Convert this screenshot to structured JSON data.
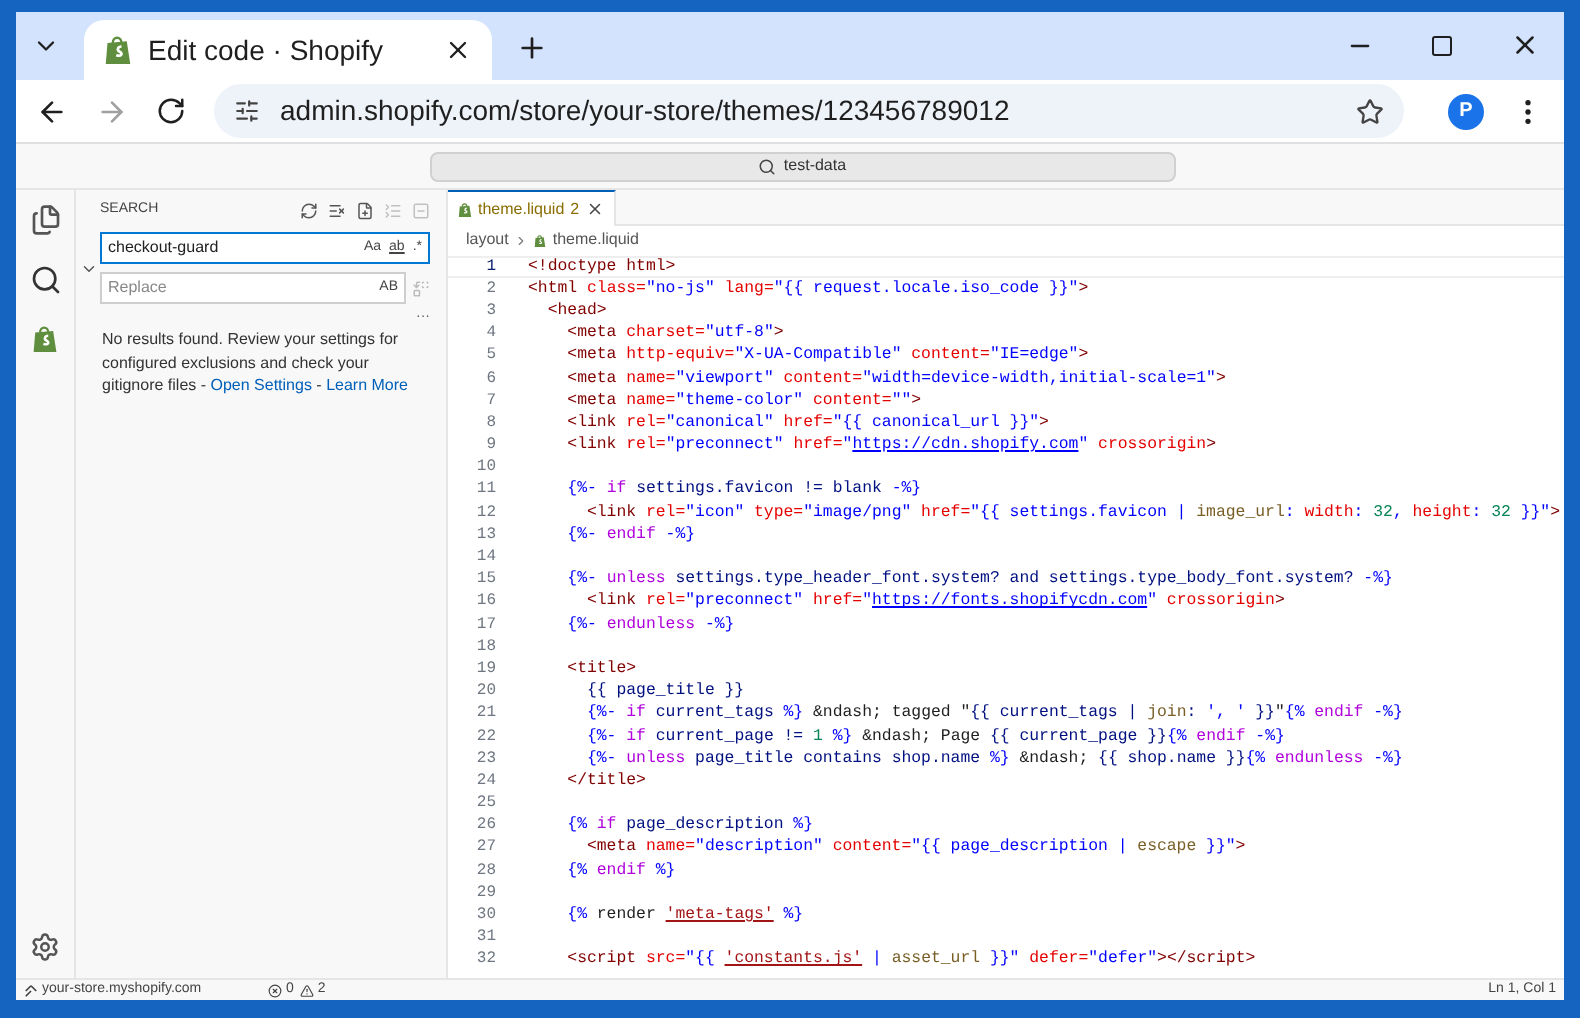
{
  "browser": {
    "tab_title": "Edit code · Shopify",
    "url": "admin.shopify.com/store/your-store/themes/123456789012",
    "profile_initial": "P"
  },
  "command_center": {
    "text": "test-data"
  },
  "search_panel": {
    "title": "SEARCH",
    "query": "checkout-guard",
    "toggles": [
      "Aa",
      "ab",
      ".*"
    ],
    "replace_placeholder": "Replace",
    "replace_toggle": "AB",
    "more": "···",
    "message": "No results found. Review your settings for configured exclusions and check your gitignore files - ",
    "links": [
      "Open Settings",
      "Learn More"
    ],
    "separator": " - "
  },
  "editor_tab": {
    "name": "theme.liquid",
    "problems": "2",
    "selected": true
  },
  "breadcrumb": [
    "layout",
    "theme.liquid"
  ],
  "code_lines": [
    {
      "n": "1",
      "current": true,
      "tokens": [
        {
          "kind": "tag",
          "text": "<!doctype html>"
        }
      ]
    },
    {
      "n": "2",
      "current": false,
      "tokens": [
        {
          "kind": "tag",
          "text": "<html"
        },
        {
          "kind": "attr",
          "text": " class="
        },
        {
          "kind": "str",
          "text": "\"no-js\""
        },
        {
          "kind": "attr",
          "text": " lang="
        },
        {
          "kind": "str",
          "text": "\"{{ request.locale.iso_code }}\""
        },
        {
          "kind": "tag",
          "text": ">"
        }
      ]
    },
    {
      "n": "3",
      "current": false,
      "tokens": [
        {
          "kind": "tag",
          "text": "  <head>"
        }
      ]
    },
    {
      "n": "4",
      "current": false,
      "tokens": [
        {
          "kind": "tag",
          "text": "    <meta"
        },
        {
          "kind": "attr",
          "text": " charset="
        },
        {
          "kind": "str",
          "text": "\"utf-8\""
        },
        {
          "kind": "tag",
          "text": ">"
        }
      ]
    },
    {
      "n": "5",
      "current": false,
      "tokens": [
        {
          "kind": "tag",
          "text": "    <meta"
        },
        {
          "kind": "attr",
          "text": " http-equiv="
        },
        {
          "kind": "str",
          "text": "\"X-UA-Compatible\""
        },
        {
          "kind": "attr",
          "text": " content="
        },
        {
          "kind": "str",
          "text": "\"IE=edge\""
        },
        {
          "kind": "tag",
          "text": ">"
        }
      ]
    },
    {
      "n": "6",
      "current": false,
      "tokens": [
        {
          "kind": "tag",
          "text": "    <meta"
        },
        {
          "kind": "attr",
          "text": " name="
        },
        {
          "kind": "str",
          "text": "\"viewport\""
        },
        {
          "kind": "attr",
          "text": " content="
        },
        {
          "kind": "str",
          "text": "\"width=device-width,initial-scale=1\""
        },
        {
          "kind": "tag",
          "text": ">"
        }
      ]
    },
    {
      "n": "7",
      "current": false,
      "tokens": [
        {
          "kind": "tag",
          "text": "    <meta"
        },
        {
          "kind": "attr",
          "text": " name="
        },
        {
          "kind": "str",
          "text": "\"theme-color\""
        },
        {
          "kind": "attr",
          "text": " content="
        },
        {
          "kind": "str",
          "text": "\"\""
        },
        {
          "kind": "tag",
          "text": ">"
        }
      ]
    },
    {
      "n": "8",
      "current": false,
      "tokens": [
        {
          "kind": "tag",
          "text": "    <link"
        },
        {
          "kind": "attr",
          "text": " rel="
        },
        {
          "kind": "str",
          "text": "\"canonical\""
        },
        {
          "kind": "attr",
          "text": " href="
        },
        {
          "kind": "str",
          "text": "\"{{ canonical_url }}\""
        },
        {
          "kind": "tag",
          "text": ">"
        }
      ]
    },
    {
      "n": "9",
      "current": false,
      "tokens": [
        {
          "kind": "tag",
          "text": "    <link"
        },
        {
          "kind": "attr",
          "text": " rel="
        },
        {
          "kind": "str",
          "text": "\"preconnect\""
        },
        {
          "kind": "attr",
          "text": " href="
        },
        {
          "kind": "str",
          "text": "\""
        },
        {
          "kind": "link",
          "text": "https://cdn.shopify.com"
        },
        {
          "kind": "str",
          "text": "\""
        },
        {
          "kind": "attr",
          "text": " crossorigin"
        },
        {
          "kind": "tag",
          "text": ">"
        }
      ]
    },
    {
      "n": "10",
      "current": false
    },
    {
      "n": "11",
      "current": false,
      "tokens": [
        {
          "kind": "punc",
          "text": "    {%-"
        },
        {
          "kind": "kw",
          "text": " if"
        },
        {
          "kind": "var",
          "text": " settings.favicon != blank"
        },
        {
          "kind": "punc",
          "text": " -%}"
        }
      ]
    },
    {
      "n": "12",
      "current": false,
      "tokens": [
        {
          "kind": "tag",
          "text": "      <link"
        },
        {
          "kind": "attr",
          "text": " rel="
        },
        {
          "kind": "str",
          "text": "\"icon\""
        },
        {
          "kind": "attr",
          "text": " type="
        },
        {
          "kind": "str",
          "text": "\"image/png\""
        },
        {
          "kind": "attr",
          "text": " href="
        },
        {
          "kind": "str",
          "text": "\"{{ settings.favicon | "
        },
        {
          "kind": "fn",
          "text": "image_url"
        },
        {
          "kind": "str",
          "text": ": "
        },
        {
          "kind": "attr",
          "text": "width"
        },
        {
          "kind": "str",
          "text": ": "
        },
        {
          "kind": "num",
          "text": "32"
        },
        {
          "kind": "str",
          "text": ", "
        },
        {
          "kind": "attr",
          "text": "height"
        },
        {
          "kind": "str",
          "text": ": "
        },
        {
          "kind": "num",
          "text": "32"
        },
        {
          "kind": "str",
          "text": " }}\""
        },
        {
          "kind": "tag",
          "text": ">"
        }
      ]
    },
    {
      "n": "13",
      "current": false,
      "tokens": [
        {
          "kind": "punc",
          "text": "    {%-"
        },
        {
          "kind": "kw",
          "text": " endif"
        },
        {
          "kind": "punc",
          "text": " -%}"
        }
      ]
    },
    {
      "n": "14",
      "current": false
    },
    {
      "n": "15",
      "current": false,
      "tokens": [
        {
          "kind": "punc",
          "text": "    {%-"
        },
        {
          "kind": "kw",
          "text": " unless"
        },
        {
          "kind": "var",
          "text": " settings.type_header_font.system? and settings.type_body_font.system?"
        },
        {
          "kind": "punc",
          "text": " -%}"
        }
      ]
    },
    {
      "n": "16",
      "current": false,
      "tokens": [
        {
          "kind": "tag",
          "text": "      <link"
        },
        {
          "kind": "attr",
          "text": " rel="
        },
        {
          "kind": "str",
          "text": "\"preconnect\""
        },
        {
          "kind": "attr",
          "text": " href="
        },
        {
          "kind": "str",
          "text": "\""
        },
        {
          "kind": "link",
          "text": "https://fonts.shopifycdn.com"
        },
        {
          "kind": "str",
          "text": "\""
        },
        {
          "kind": "attr",
          "text": " crossorigin"
        },
        {
          "kind": "tag",
          "text": ">"
        }
      ]
    },
    {
      "n": "17",
      "current": false,
      "tokens": [
        {
          "kind": "punc",
          "text": "    {%-"
        },
        {
          "kind": "kw",
          "text": " endunless"
        },
        {
          "kind": "punc",
          "text": " -%}"
        }
      ]
    },
    {
      "n": "18",
      "current": false
    },
    {
      "n": "19",
      "current": false,
      "tokens": [
        {
          "kind": "tag",
          "text": "    <title>"
        }
      ]
    },
    {
      "n": "20",
      "current": false,
      "tokens": [
        {
          "kind": "var",
          "text": "      {{ page_title }}"
        }
      ]
    },
    {
      "n": "21",
      "current": false,
      "tokens": [
        {
          "kind": "punc",
          "text": "      {%-"
        },
        {
          "kind": "kw",
          "text": " if"
        },
        {
          "kind": "var",
          "text": " current_tags"
        },
        {
          "kind": "punc",
          "text": " %}"
        },
        {
          "kind": "plain",
          "text": " &ndash; tagged \""
        },
        {
          "kind": "var",
          "text": "{{ current_tags | "
        },
        {
          "kind": "fn",
          "text": "join"
        },
        {
          "kind": "var",
          "text": ": "
        },
        {
          "kind": "str",
          "text": "', '"
        },
        {
          "kind": "var",
          "text": " }}"
        },
        {
          "kind": "plain",
          "text": "\""
        },
        {
          "kind": "punc",
          "text": "{%"
        },
        {
          "kind": "kw",
          "text": " endif"
        },
        {
          "kind": "punc",
          "text": " -%}"
        }
      ]
    },
    {
      "n": "22",
      "current": false,
      "tokens": [
        {
          "kind": "punc",
          "text": "      {%-"
        },
        {
          "kind": "kw",
          "text": " if"
        },
        {
          "kind": "var",
          "text": " current_page != "
        },
        {
          "kind": "num",
          "text": "1"
        },
        {
          "kind": "punc",
          "text": " %}"
        },
        {
          "kind": "plain",
          "text": " &ndash; Page "
        },
        {
          "kind": "var",
          "text": "{{ current_page }}"
        },
        {
          "kind": "punc",
          "text": "{%"
        },
        {
          "kind": "kw",
          "text": " endif"
        },
        {
          "kind": "punc",
          "text": " -%}"
        }
      ]
    },
    {
      "n": "23",
      "current": false,
      "tokens": [
        {
          "kind": "punc",
          "text": "      {%-"
        },
        {
          "kind": "kw",
          "text": " unless"
        },
        {
          "kind": "var",
          "text": " page_title contains shop.name"
        },
        {
          "kind": "punc",
          "text": " %}"
        },
        {
          "kind": "plain",
          "text": " &ndash; "
        },
        {
          "kind": "var",
          "text": "{{ shop.name }}"
        },
        {
          "kind": "punc",
          "text": "{%"
        },
        {
          "kind": "kw",
          "text": " endunless"
        },
        {
          "kind": "punc",
          "text": " -%}"
        }
      ]
    },
    {
      "n": "24",
      "current": false,
      "tokens": [
        {
          "kind": "tag",
          "text": "    </title>"
        }
      ]
    },
    {
      "n": "25",
      "current": false
    },
    {
      "n": "26",
      "current": false,
      "tokens": [
        {
          "kind": "punc",
          "text": "    {%"
        },
        {
          "kind": "kw",
          "text": " if"
        },
        {
          "kind": "var",
          "text": " page_description"
        },
        {
          "kind": "punc",
          "text": " %}"
        }
      ]
    },
    {
      "n": "27",
      "current": false,
      "tokens": [
        {
          "kind": "tag",
          "text": "      <meta"
        },
        {
          "kind": "attr",
          "text": " name="
        },
        {
          "kind": "str",
          "text": "\"description\""
        },
        {
          "kind": "attr",
          "text": " content="
        },
        {
          "kind": "str",
          "text": "\"{{ page_description | "
        },
        {
          "kind": "fn",
          "text": "escape"
        },
        {
          "kind": "str",
          "text": " }}\""
        },
        {
          "kind": "tag",
          "text": ">"
        }
      ]
    },
    {
      "n": "28",
      "current": false,
      "tokens": [
        {
          "kind": "punc",
          "text": "    {%"
        },
        {
          "kind": "kw",
          "text": " endif"
        },
        {
          "kind": "punc",
          "text": " %}"
        }
      ]
    },
    {
      "n": "29",
      "current": false
    },
    {
      "n": "30",
      "current": false,
      "tokens": [
        {
          "kind": "punc",
          "text": "    {%"
        },
        {
          "kind": "plain",
          "text": " render "
        },
        {
          "kind": "sq",
          "text": "'meta-tags'"
        },
        {
          "kind": "punc",
          "text": " %}"
        }
      ]
    },
    {
      "n": "31",
      "current": false
    },
    {
      "n": "32",
      "current": false,
      "tokens": [
        {
          "kind": "tag",
          "text": "    <script"
        },
        {
          "kind": "attr",
          "text": " src="
        },
        {
          "kind": "str",
          "text": "\"{{ "
        },
        {
          "kind": "sq",
          "text": "'constants.js'"
        },
        {
          "kind": "str",
          "text": " | "
        },
        {
          "kind": "fn",
          "text": "asset_url"
        },
        {
          "kind": "str",
          "text": " }}\""
        },
        {
          "kind": "attr",
          "text": " defer="
        },
        {
          "kind": "str",
          "text": "\"defer\""
        },
        {
          "kind": "tag",
          "text": "></script>"
        }
      ]
    }
  ],
  "status_bar": {
    "remote": "your-store.myshopify.com",
    "errors": "0",
    "warnings": "2",
    "position": "Ln 1, Col 1"
  }
}
